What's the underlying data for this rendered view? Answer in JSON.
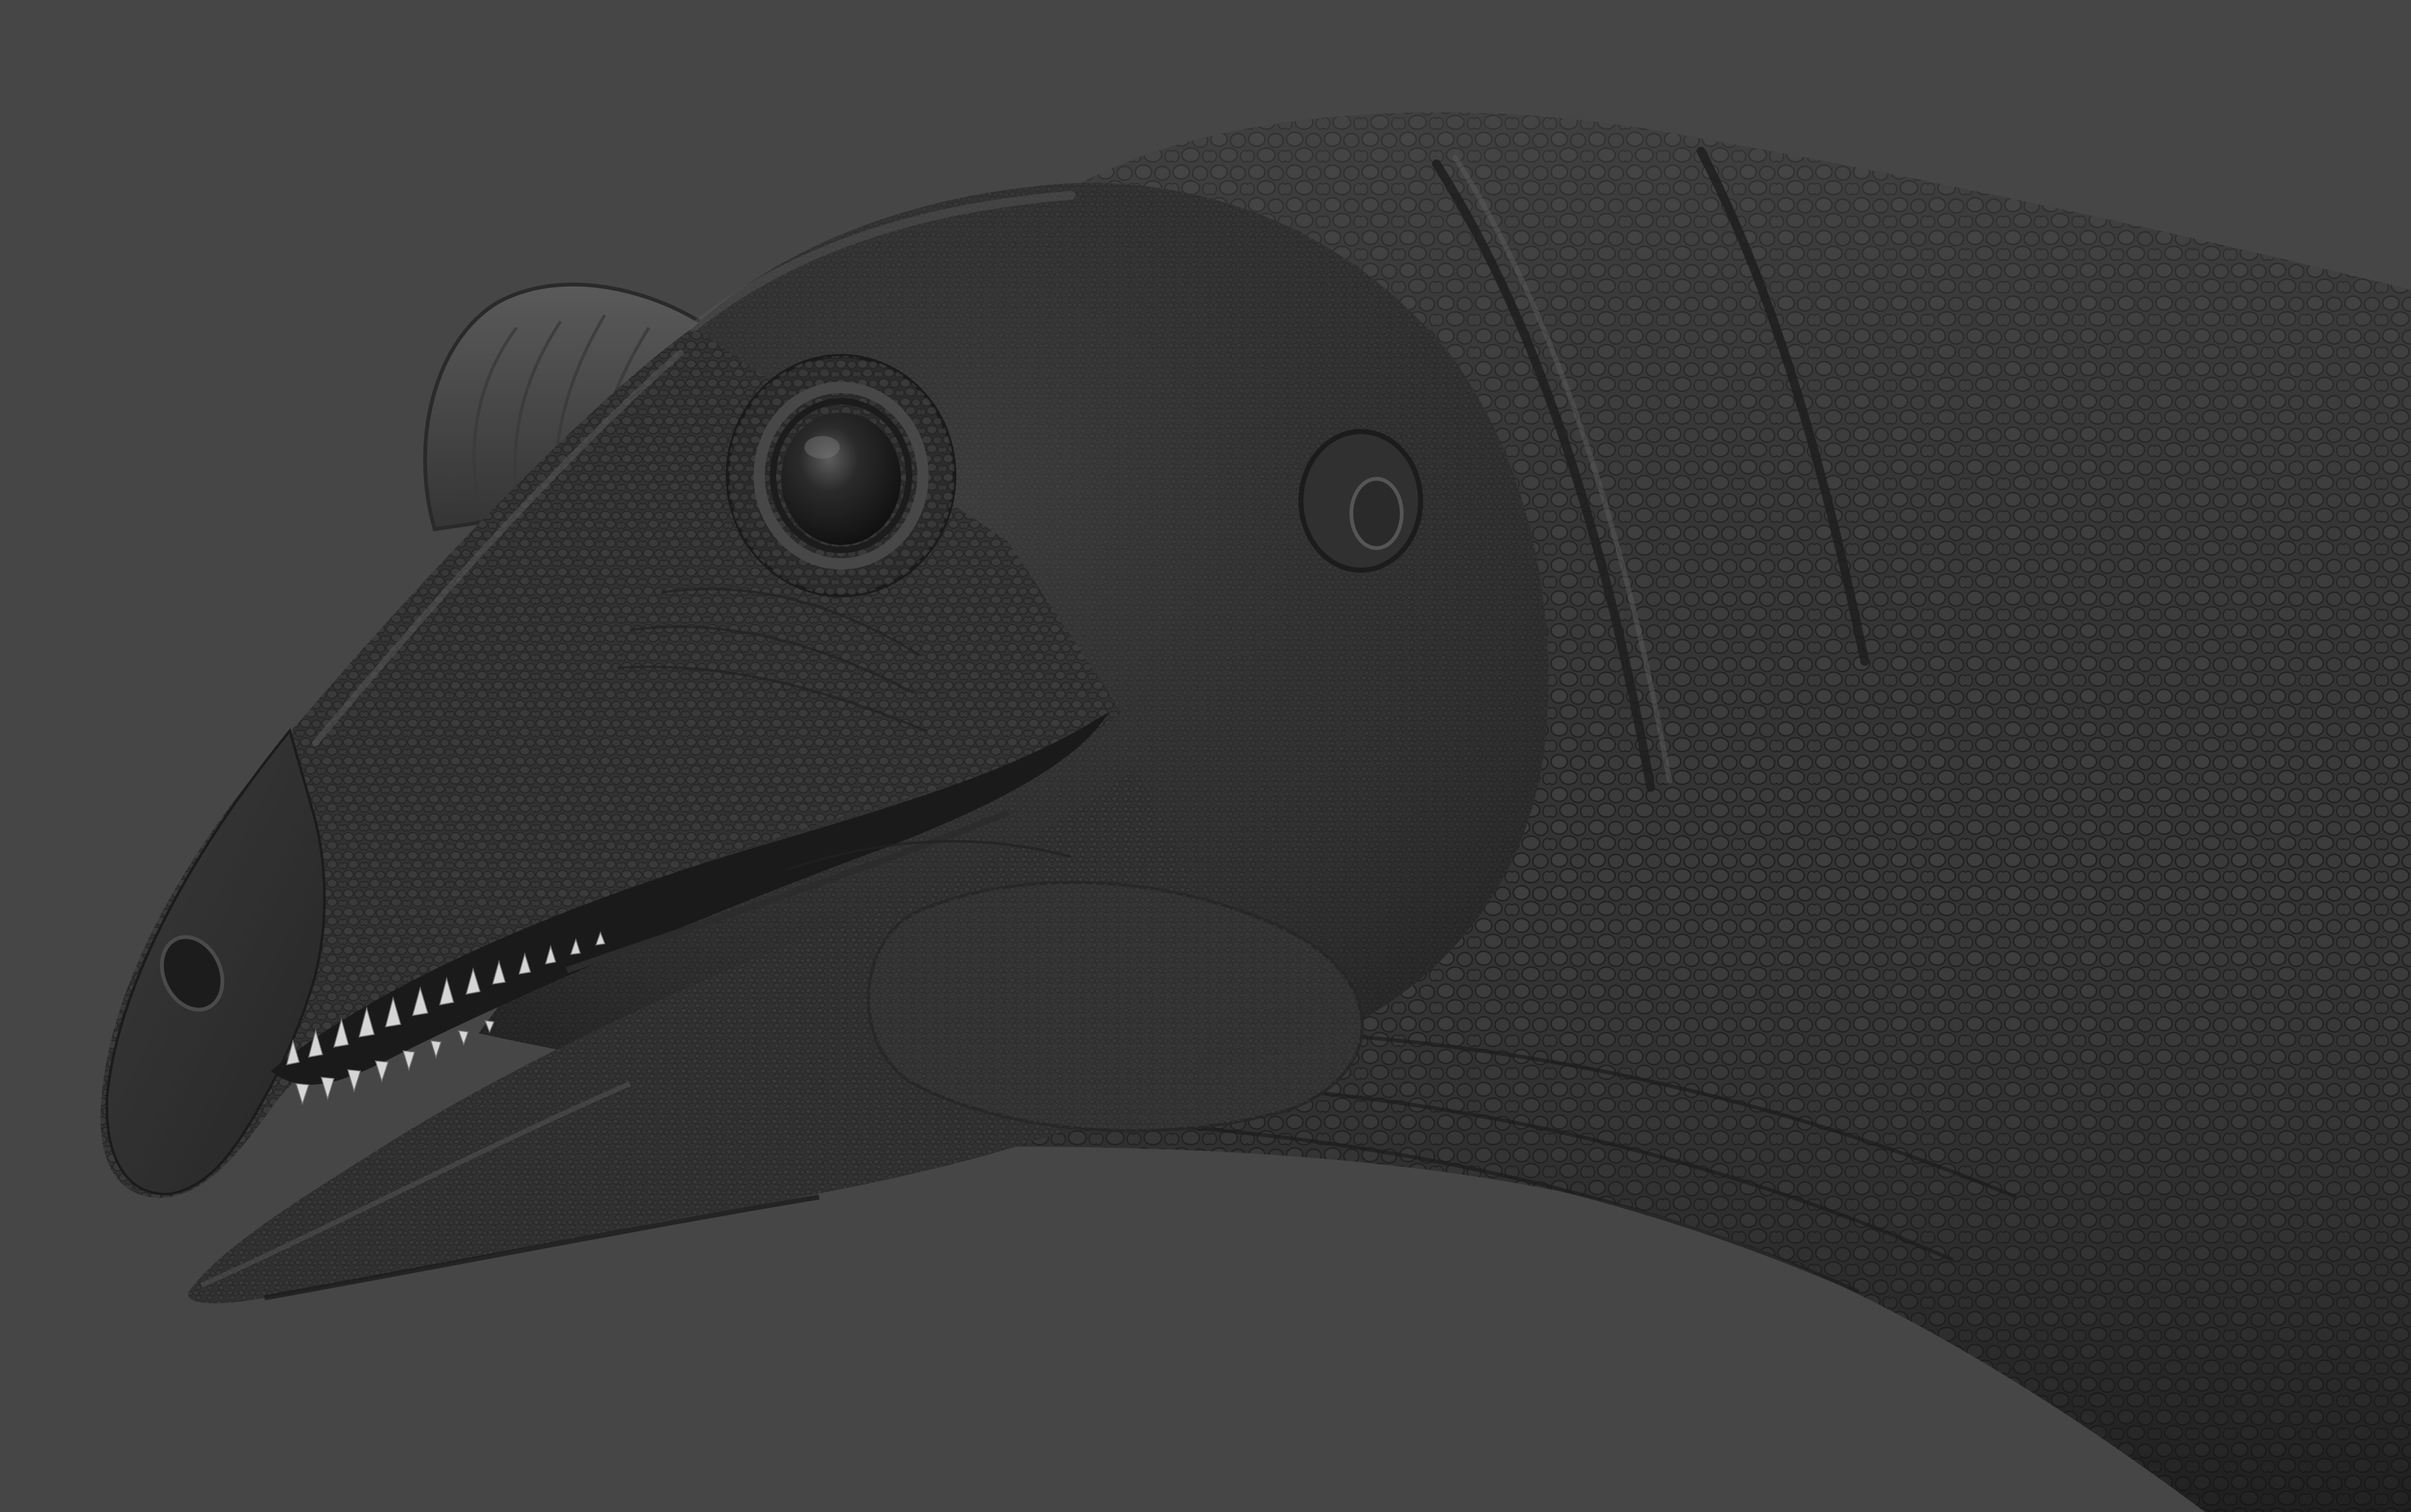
{
  "scene": {
    "subject": "dinosaur-head-sculpt",
    "render_style": "matcap-grey",
    "colors": {
      "background": "#464646",
      "skin_base": "#333333",
      "skin_dark": "#202020",
      "skin_light": "#5a5a5a",
      "crest": "#4a4a4a",
      "eye": "#151515",
      "teeth": "#d6d6d6",
      "mouth_interior": "#1a1a1a"
    }
  }
}
